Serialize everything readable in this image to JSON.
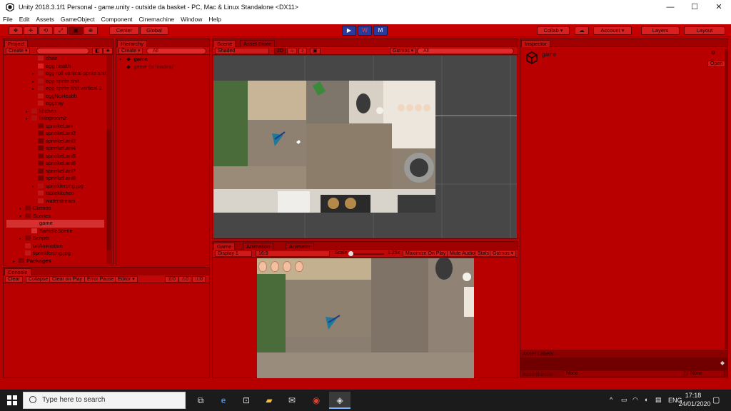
{
  "window": {
    "title": "Unity 2018.3.1f1 Personal - game.unity - outside da basket - PC, Mac & Linux Standalone <DX11>",
    "controls": [
      "—",
      "☐",
      "✕"
    ]
  },
  "menu": [
    "File",
    "Edit",
    "Assets",
    "GameObject",
    "Component",
    "Cinemachine",
    "Window",
    "Help"
  ],
  "toolbar": {
    "tools": [
      "✥",
      "✛",
      "⟲",
      "⤢",
      "▣",
      "⊕"
    ],
    "pivot": "Center",
    "space": "Global",
    "play": "▶",
    "pause": "W",
    "step": "M",
    "collab": "Collab ▾",
    "cloud": "☁",
    "account": "Account ▾",
    "layers": "Layers",
    "layout": "Layout"
  },
  "project": {
    "tab": "Project",
    "create": "Create ▾",
    "items": [
      {
        "label": "chair",
        "indent": 2,
        "arrow": "",
        "color": "#c01818"
      },
      {
        "label": "egg health",
        "indent": 2,
        "arrow": "",
        "color": "#e02020"
      },
      {
        "label": "egg roll vertical sprite shit",
        "indent": 2,
        "arrow": "▸",
        "color": "#b01010"
      },
      {
        "label": "egg sprite shit",
        "indent": 2,
        "arrow": "▸",
        "color": "#b01010"
      },
      {
        "label": "egg sprite shit vertical 2",
        "indent": 2,
        "arrow": "▸",
        "color": "#b01010"
      },
      {
        "label": "eggNoHealth",
        "indent": 2,
        "arrow": "",
        "color": "#c01818"
      },
      {
        "label": "eggtray",
        "indent": 2,
        "arrow": "",
        "color": "#c01818"
      },
      {
        "label": "kitchen",
        "indent": 1,
        "arrow": "▸",
        "color": "#b01010"
      },
      {
        "label": "livingroom2",
        "indent": 1,
        "arrow": "▸",
        "color": "#b01010"
      },
      {
        "label": "sprinkel.ani",
        "indent": 2,
        "arrow": "",
        "color": "#7a0000"
      },
      {
        "label": "sprinkel.ani2",
        "indent": 2,
        "arrow": "",
        "color": "#7a0000"
      },
      {
        "label": "sprinkel.ani3",
        "indent": 2,
        "arrow": "",
        "color": "#7a0000"
      },
      {
        "label": "sprinkel.ani4",
        "indent": 2,
        "arrow": "",
        "color": "#7a0000"
      },
      {
        "label": "sprinkel.ani5",
        "indent": 2,
        "arrow": "",
        "color": "#7a0000"
      },
      {
        "label": "sprinkel.ani6",
        "indent": 2,
        "arrow": "",
        "color": "#7a0000"
      },
      {
        "label": "sprinkel.ani7",
        "indent": 2,
        "arrow": "",
        "color": "#7a0000"
      },
      {
        "label": "sprinkel.ani8",
        "indent": 2,
        "arrow": "",
        "color": "#7a0000"
      },
      {
        "label": "sprinklerpng.jpg",
        "indent": 2,
        "arrow": "▸",
        "color": "#b01010"
      },
      {
        "label": "tablekitchen",
        "indent": 2,
        "arrow": "",
        "color": "#c01818"
      },
      {
        "label": "waterstream",
        "indent": 2,
        "arrow": "",
        "color": "#c01818"
      },
      {
        "label": "Gizmos",
        "indent": 0,
        "arrow": "▸",
        "color": "#8a0000"
      },
      {
        "label": "Scenes",
        "indent": 0,
        "arrow": "▾",
        "color": "#8a0000"
      },
      {
        "label": "game",
        "indent": 1,
        "arrow": "",
        "color": "#d83030",
        "selected": true
      },
      {
        "label": "SampleScene",
        "indent": 1,
        "arrow": "",
        "color": "#d83030"
      },
      {
        "label": "Scripts",
        "indent": 0,
        "arrow": "▸",
        "color": "#8a0000"
      },
      {
        "label": "onAnimation",
        "indent": 0,
        "arrow": "",
        "color": "#c01818"
      },
      {
        "label": "sprinklerpng.jpg",
        "indent": 0,
        "arrow": "",
        "color": "#c01818"
      },
      {
        "label": "Packages",
        "indent": -1,
        "arrow": "▸",
        "color": "#8a0000"
      }
    ]
  },
  "hierarchy": {
    "tab": "Hierarchy",
    "create": "Create ▾",
    "search": "All",
    "items": [
      {
        "label": "game",
        "sub": false
      },
      {
        "label": "game (is loading)",
        "sub": true
      }
    ]
  },
  "console": {
    "tab": "Console",
    "buttons": [
      "Clear",
      "Collapse",
      "Clear on Play",
      "Error Pause",
      "Editor ▾"
    ],
    "counts": [
      "0",
      "0",
      "0"
    ]
  },
  "scene": {
    "tabs": [
      "Scene",
      "Asset Store"
    ],
    "shading": "Shaded",
    "mode": "2D",
    "gizmos": "Gizmos ▾",
    "search": "All"
  },
  "game": {
    "tabs": [
      "Game",
      "Animation",
      "Animator"
    ],
    "display": "Display 1",
    "aspect": "16:9",
    "scale_label": "Scale",
    "scale_value": "1.26x",
    "buttons": [
      "Maximize On Play",
      "Mute Audio",
      "Stats",
      "Gizmos ▾"
    ],
    "lives": 4
  },
  "inspector": {
    "tab": "Inspector",
    "object": "game",
    "open": "Open",
    "asset_labels": "Asset Labels",
    "asset_bundle": "AssetBundle",
    "bundle_value": "None",
    "variant_value": "None"
  },
  "taskbar": {
    "search": "Type here to search",
    "apps": [
      "⊞",
      "e",
      "🛍",
      "📁",
      "✉",
      "●",
      "◆"
    ],
    "time": "17:18",
    "date": "24/01/2020",
    "lang": "ENG"
  },
  "colors": {
    "editor_tint": "#b80000",
    "play_blue": "#2a3a9a"
  }
}
